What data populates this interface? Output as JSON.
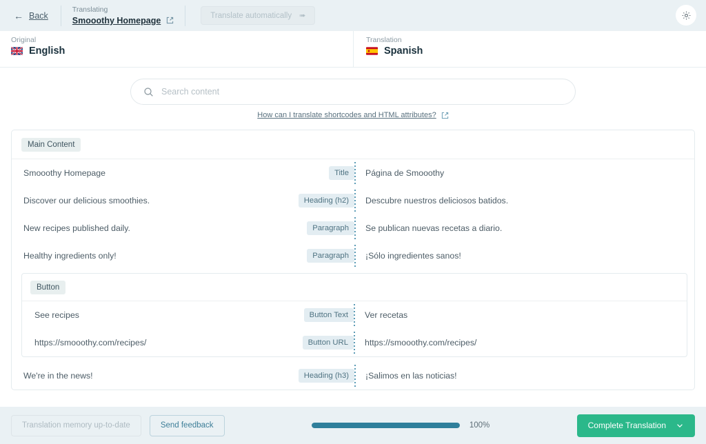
{
  "topbar": {
    "back_label": "Back",
    "translating_label": "Translating",
    "page_title": "Smooothy Homepage",
    "auto_translate_label": "Translate automatically",
    "settings_icon": "gear-icon",
    "external_link_icon": "external-link-icon",
    "bolt_icon": "lightning-bolt-icon"
  },
  "languages": {
    "original_label": "Original",
    "original_language": "English",
    "original_flag": "uk-flag",
    "translation_label": "Translation",
    "translation_language": "Spanish",
    "translation_flag": "spain-flag"
  },
  "search": {
    "placeholder": "Search content",
    "value": "",
    "search_icon": "search-icon",
    "close_icon": "close-icon",
    "help_link": "How can I translate shortcodes and HTML attributes?",
    "help_external_icon": "external-link-icon"
  },
  "content": {
    "group_label": "Main Content",
    "rows": [
      {
        "source": "Smooothy Homepage",
        "type": "Title",
        "target": "Página de Smooothy"
      },
      {
        "source": "Discover our delicious smoothies.",
        "type": "Heading (h2)",
        "target": "Descubre nuestros deliciosos batidos."
      },
      {
        "source": "New recipes published daily.",
        "type": "Paragraph",
        "target": "Se publican nuevas recetas a diario."
      },
      {
        "source": "Healthy ingredients only!",
        "type": "Paragraph",
        "target": "¡Sólo ingredientes sanos!"
      }
    ],
    "button_group": {
      "group_label": "Button",
      "rows": [
        {
          "source": "See recipes",
          "type": "Button Text",
          "target": "Ver recetas"
        },
        {
          "source": "https://smooothy.com/recipes/",
          "type": "Button URL",
          "target": "https://smooothy.com/recipes/"
        }
      ]
    },
    "trailing_rows": [
      {
        "source": "We're in the news!",
        "type": "Heading (h3)",
        "target": "¡Salimos en las noticias!"
      }
    ]
  },
  "footer": {
    "memory_label": "Translation memory up-to-date",
    "feedback_label": "Send feedback",
    "progress_percent": "100%",
    "progress_value": 100,
    "complete_label": "Complete Translation",
    "complete_chevron_icon": "chevron-down-icon"
  },
  "colors": {
    "accent_teal": "#2f7f9b",
    "primary_green": "#2bb88a",
    "bar_bg": "#eaf1f4",
    "badge_bg": "#e3edf2"
  }
}
